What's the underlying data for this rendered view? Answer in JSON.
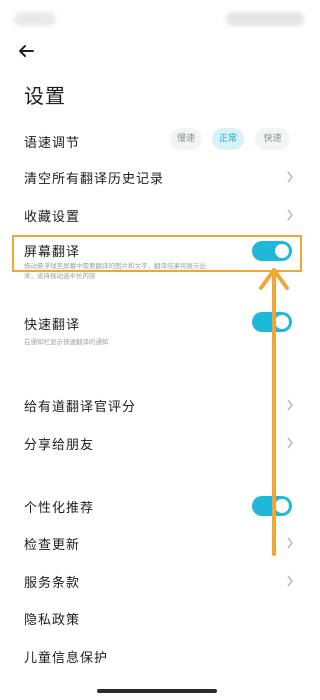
{
  "page": {
    "title": "设置",
    "accent_color": "#1fb8db",
    "highlight_color": "#f2a532"
  },
  "speech_rate": {
    "label": "语速调节",
    "options": [
      "慢速",
      "正常",
      "快速"
    ],
    "selected": "正常"
  },
  "items": {
    "clear_history": "清空所有翻译历史记录",
    "favorites": "收藏设置",
    "screen_translate": {
      "label": "屏幕翻译",
      "enabled": true,
      "desc_line1": "拖动悬浮球至屏幕中需要翻译的图片和文字，翻译结果将展示出",
      "desc_line2": "来，支持拖动选中长内容"
    },
    "quick_translate": {
      "label": "快速翻译",
      "enabled": true,
      "desc": "在通知栏显示快速翻译的通知"
    },
    "rate": "给有道翻译官评分",
    "share": "分享给朋友",
    "personalized": {
      "label": "个性化推荐",
      "enabled": true
    },
    "check_update": "检查更新",
    "terms": "服务条款",
    "privacy": "隐私政策",
    "child_privacy": "儿童信息保护"
  },
  "icons": {
    "back": "back-arrow-icon",
    "chevron": "chevron-right-icon",
    "annotation": "orange-up-arrow"
  }
}
